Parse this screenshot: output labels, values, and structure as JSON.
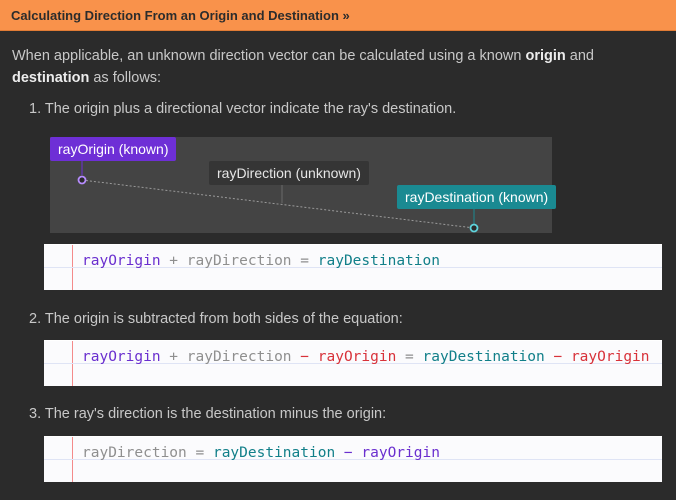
{
  "header": {
    "link_label": "Calculating Direction From an Origin and Destination »"
  },
  "intro": {
    "part1": "When applicable, an unknown direction vector can be calculated using a known ",
    "origin_bold": "origin",
    "part2": " and ",
    "destination_bold": "destination",
    "part3": " as follows:"
  },
  "steps": [
    {
      "text": "1. The origin plus a directional vector indicate the ray's destination."
    },
    {
      "text": "2. The origin is subtracted from both sides of the equation:"
    },
    {
      "text": "3. The ray's direction is the destination minus the origin:"
    }
  ],
  "diagram": {
    "origin_label": "rayOrigin (known)",
    "direction_label": "rayDirection (unknown)",
    "destination_label": "rayDestination (known)"
  },
  "equations": [
    [
      {
        "t": "rayOrigin",
        "c": "purple"
      },
      {
        "t": " + ",
        "c": "gray"
      },
      {
        "t": "rayDirection",
        "c": "gray"
      },
      {
        "t": " = ",
        "c": "gray"
      },
      {
        "t": "rayDestination",
        "c": "teal"
      }
    ],
    [
      {
        "t": "rayOrigin",
        "c": "purple"
      },
      {
        "t": " + ",
        "c": "gray"
      },
      {
        "t": "rayDirection",
        "c": "gray"
      },
      {
        "t": " − ",
        "c": "red"
      },
      {
        "t": "rayOrigin",
        "c": "red"
      },
      {
        "t": " = ",
        "c": "gray"
      },
      {
        "t": "rayDestination",
        "c": "teal"
      },
      {
        "t": " − ",
        "c": "red"
      },
      {
        "t": "rayOrigin",
        "c": "red"
      }
    ],
    [
      {
        "t": "rayDirection",
        "c": "gray"
      },
      {
        "t": " = ",
        "c": "gray"
      },
      {
        "t": "rayDestination",
        "c": "teal"
      },
      {
        "t": " − ",
        "c": "purple"
      },
      {
        "t": "rayOrigin",
        "c": "purple"
      }
    ]
  ],
  "colors": {
    "header_bg": "#f9924b",
    "origin": "#6e2fd6",
    "destination": "#1a8a92"
  }
}
